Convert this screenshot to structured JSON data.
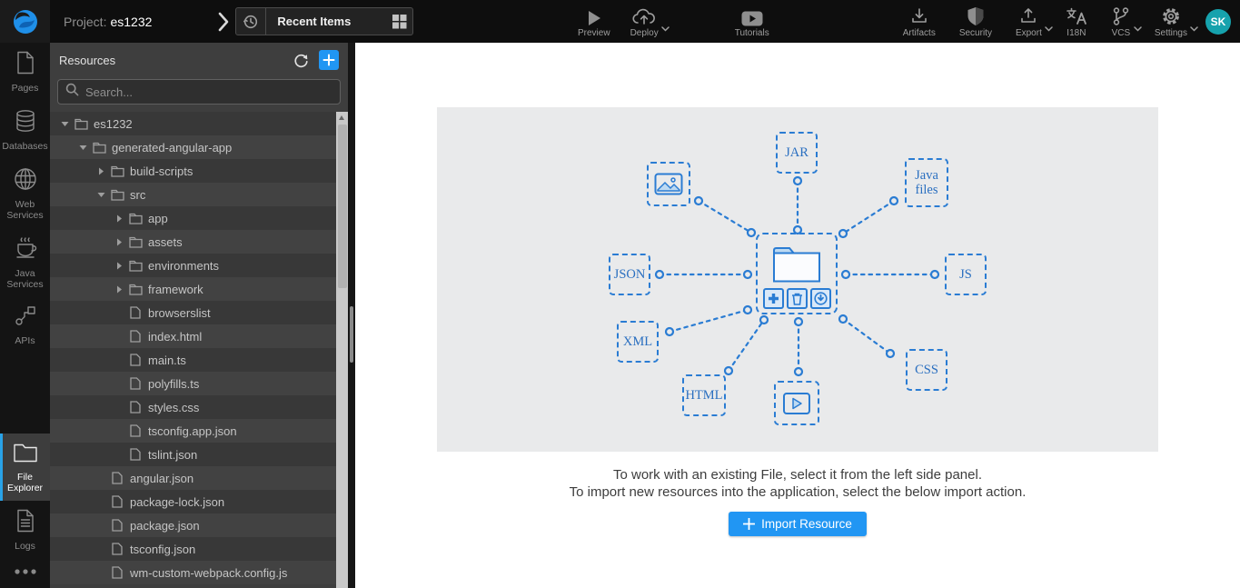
{
  "topbar": {
    "project_label": "Project:",
    "project_name": "es1232",
    "recent_items_label": "Recent Items",
    "center_actions": [
      {
        "label": "Preview",
        "icon": "play-icon",
        "chevron": false
      },
      {
        "label": "Deploy",
        "icon": "cloud-upload-icon",
        "chevron": true
      },
      {
        "label": "Tutorials",
        "icon": "video-tutorials-icon",
        "chevron": false
      }
    ],
    "right_actions": [
      {
        "label": "Artifacts",
        "icon": "download-tray-icon",
        "chevron": false
      },
      {
        "label": "Security",
        "icon": "shield-icon",
        "chevron": false
      },
      {
        "label": "Export",
        "icon": "upload-tray-icon",
        "chevron": true
      },
      {
        "label": "I18N",
        "icon": "translate-icon",
        "chevron": false
      },
      {
        "label": "VCS",
        "icon": "branch-icon",
        "chevron": true
      },
      {
        "label": "Settings",
        "icon": "gear-icon",
        "chevron": true
      }
    ],
    "avatar_initials": "SK"
  },
  "sidebar": {
    "items": [
      {
        "label": "Pages",
        "icon": "pages-icon",
        "active": false
      },
      {
        "label": "Databases",
        "icon": "databases-icon",
        "active": false
      },
      {
        "label": "Web Services",
        "icon": "web-services-icon",
        "active": false
      },
      {
        "label": "Java Services",
        "icon": "java-services-icon",
        "active": false
      },
      {
        "label": "APIs",
        "icon": "apis-icon",
        "active": false
      },
      {
        "label": "File Explorer",
        "icon": "file-explorer-icon",
        "active": true
      },
      {
        "label": "Logs",
        "icon": "logs-icon",
        "active": false
      }
    ]
  },
  "resources_panel": {
    "title": "Resources",
    "search_placeholder": "Search...",
    "tree": [
      {
        "label": "es1232",
        "level": 0,
        "kind": "folder",
        "state": "open"
      },
      {
        "label": "generated-angular-app",
        "level": 1,
        "kind": "folder",
        "state": "open"
      },
      {
        "label": "build-scripts",
        "level": 2,
        "kind": "folder",
        "state": "closed"
      },
      {
        "label": "src",
        "level": 2,
        "kind": "folder",
        "state": "open"
      },
      {
        "label": "app",
        "level": 3,
        "kind": "folder",
        "state": "closed"
      },
      {
        "label": "assets",
        "level": 3,
        "kind": "folder",
        "state": "closed"
      },
      {
        "label": "environments",
        "level": 3,
        "kind": "folder",
        "state": "closed"
      },
      {
        "label": "framework",
        "level": 3,
        "kind": "folder",
        "state": "closed"
      },
      {
        "label": "browserslist",
        "level": 3,
        "kind": "file",
        "state": "none"
      },
      {
        "label": "index.html",
        "level": 3,
        "kind": "file",
        "state": "none"
      },
      {
        "label": "main.ts",
        "level": 3,
        "kind": "file",
        "state": "none"
      },
      {
        "label": "polyfills.ts",
        "level": 3,
        "kind": "file",
        "state": "none"
      },
      {
        "label": "styles.css",
        "level": 3,
        "kind": "file",
        "state": "none"
      },
      {
        "label": "tsconfig.app.json",
        "level": 3,
        "kind": "file",
        "state": "none"
      },
      {
        "label": "tslint.json",
        "level": 3,
        "kind": "file",
        "state": "none"
      },
      {
        "label": "angular.json",
        "level": 2,
        "kind": "file",
        "state": "none"
      },
      {
        "label": "package-lock.json",
        "level": 2,
        "kind": "file",
        "state": "none"
      },
      {
        "label": "package.json",
        "level": 2,
        "kind": "file",
        "state": "none"
      },
      {
        "label": "tsconfig.json",
        "level": 2,
        "kind": "file",
        "state": "none"
      },
      {
        "label": "wm-custom-webpack.config.js",
        "level": 2,
        "kind": "file",
        "state": "none"
      }
    ]
  },
  "main": {
    "diagram": {
      "accent_color": "#2a7cd3",
      "nodes": {
        "jar": "JAR",
        "java_files": "Java files",
        "json": "JSON",
        "js": "JS",
        "xml": "XML",
        "css": "CSS",
        "html": "HTML",
        "image_node": "image-icon",
        "video_node": "video-icon",
        "central_node": "folder-icon"
      }
    },
    "instructions": {
      "line1": "To work with an existing File, select it from the left side panel.",
      "line2": "To import new resources into the application, select the below import action."
    },
    "import_button_label": "Import Resource"
  }
}
